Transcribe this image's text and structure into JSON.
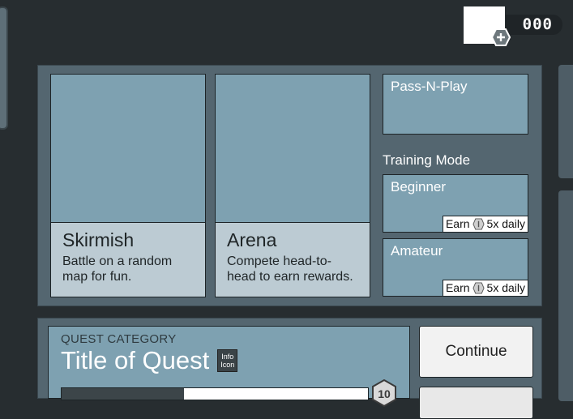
{
  "currency": {
    "amount": "000",
    "icon": "plus-hex-icon"
  },
  "modes": {
    "skirmish": {
      "title": "Skirmish",
      "description": "Battle on a random map for fun."
    },
    "arena": {
      "title": "Arena",
      "description": "Compete head-to-head to earn rewards."
    },
    "pass_n_play": {
      "title": "Pass-N-Play"
    },
    "training": {
      "label": "Training Mode",
      "beginner": {
        "title": "Beginner",
        "earn_prefix": "Earn",
        "earn_suffix": "5x daily"
      },
      "amateur": {
        "title": "Amateur",
        "earn_prefix": "Earn",
        "earn_suffix": "5x daily"
      }
    }
  },
  "quest": {
    "category": "QUEST CATEGORY",
    "title": "Title of Quest",
    "info_icon_line1": "Info",
    "info_icon_line2": "Icon",
    "progress_fraction": 0.4,
    "level": "10",
    "continue_label": "Continue"
  },
  "colors": {
    "background": "#272d30",
    "panel": "#546670",
    "card": "#7ea1b1",
    "caption": "#bccbd3"
  }
}
